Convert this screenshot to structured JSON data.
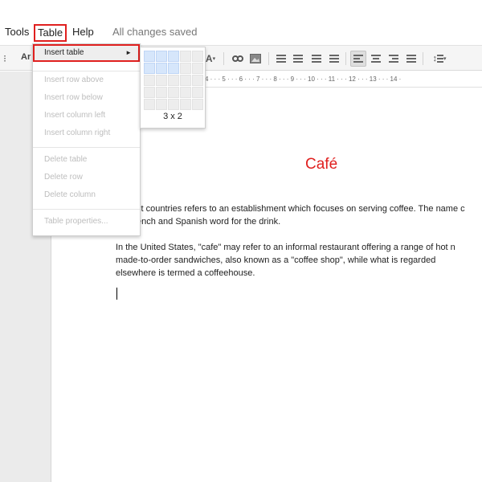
{
  "menubar": {
    "tools": "Tools",
    "table": "Table",
    "help": "Help",
    "save_status": "All changes saved"
  },
  "toolbar": {
    "font_label": "Ar",
    "icons": [
      "drag-handle-icon",
      "text-color-icon",
      "link-icon",
      "image-icon",
      "numbered-list-icon",
      "bulleted-list-icon",
      "decrease-indent-icon",
      "increase-indent-icon",
      "align-left-icon",
      "align-center-icon",
      "align-right-icon",
      "justify-icon",
      "line-spacing-icon"
    ],
    "colors": {
      "bar_bg": "#f5f5f5",
      "active_bg": "#dedede"
    }
  },
  "ruler": {
    "marks": "4 · · · 5 · · · 6 · · · 7 · · · 8 · · · 9 · · · 10 · · · 11 · · · 12 · · · 13 · · · 14 ·"
  },
  "table_menu": {
    "insert_table": "Insert table",
    "insert_arrow": "►",
    "insert_row_above": "Insert row above",
    "insert_row_below": "Insert row below",
    "insert_column_left": "Insert column left",
    "insert_column_right": "Insert column right",
    "delete_table": "Delete table",
    "delete_row": "Delete row",
    "delete_column": "Delete column",
    "table_properties": "Table properties..."
  },
  "grid_picker": {
    "selected_columns": 3,
    "selected_rows": 2,
    "size_label": "3 x 2"
  },
  "document": {
    "title": "Café",
    "title_color": "#e0201f",
    "para1_line1": "st countries refers to an establishment which focuses on serving coffee. The name c",
    "para1_line2": "ench and Spanish word for the drink.",
    "para2_line1": "In  the  United  States,  \"cafe\"  may  refer  to  an  informal  restaurant  offering  a  range  of  hot  n",
    "para2_line2": "made-to-order  sandwiches,  also  known  as  a  \"coffee  shop\",  while  what  is  regarded",
    "para2_line3": "elsewhere is termed a coffeehouse."
  },
  "highlight_color": "#e0201f"
}
